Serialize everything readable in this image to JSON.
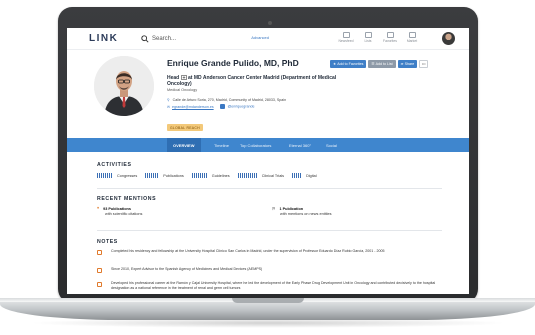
{
  "app": {
    "logo": "LINK"
  },
  "search": {
    "placeholder": "Search...",
    "advanced": "Advanced"
  },
  "nav": [
    {
      "label": "Newsfeed"
    },
    {
      "label": "Lists"
    },
    {
      "label": "Favorites"
    },
    {
      "label": "Market"
    }
  ],
  "profile": {
    "name": "Enrique Grande Pulido, MD, PhD",
    "position_prefix": "Head",
    "position_rest": "at MD Anderson Cancer Center Madrid (Department of Medical Oncology)",
    "department": "Medical Oncology",
    "address": "Calle de Arturo Soria, 270, Madrid, Community of Madrid, 28033, Spain",
    "email": "egrande@mdanderson.es",
    "twitter": "@enriquegrande",
    "badge": "GLOBAL REACH"
  },
  "actions": {
    "favorites": "Add to Favorites",
    "list": "Add to List",
    "share": "Share",
    "more": "•••"
  },
  "tabs": [
    {
      "label": "OVERVIEW"
    },
    {
      "label": "Timeline"
    },
    {
      "label": "Top Collaborators"
    },
    {
      "label": "Eternal 360°"
    },
    {
      "label": "Social"
    }
  ],
  "activities": {
    "title": "ACTIVITIES",
    "items": [
      {
        "label": "Congresses"
      },
      {
        "label": "Publications"
      },
      {
        "label": "Guidelines"
      },
      {
        "label": "Clinical Trials"
      },
      {
        "label": "Digital"
      }
    ]
  },
  "recent_mentions": {
    "title": "RECENT MENTIONS",
    "items": [
      {
        "count": "93 Publications",
        "detail": "with scientific citations"
      },
      {
        "count": "1 Publication",
        "detail": "with mentions on news entities"
      }
    ]
  },
  "notes": {
    "title": "NOTES",
    "items": [
      {
        "text": "Completed his residency and fellowship at the University Hospital Clínico San Carlos in Madrid, under the supervision of Professor Eduardo Díaz Rubio García, 2001 - 2005"
      },
      {
        "text": "Since 2010, Expert Advisor to the Spanish Agency of Medicines and Medical Devices (AEMPS)"
      },
      {
        "text": "Developed his professional career at the Ramón y Cajal University Hospital, where he led the development of the Early Phase Drug Development Unit in Oncology and contributed decisively to the hospital designation as a national reference in the treatment of renal and germ cell tumors"
      }
    ]
  },
  "colors": {
    "accent": "#3f86ce",
    "accent_dark": "#2f6eb3",
    "badge": "#f3c97a",
    "note_icon": "#e07a2c"
  }
}
